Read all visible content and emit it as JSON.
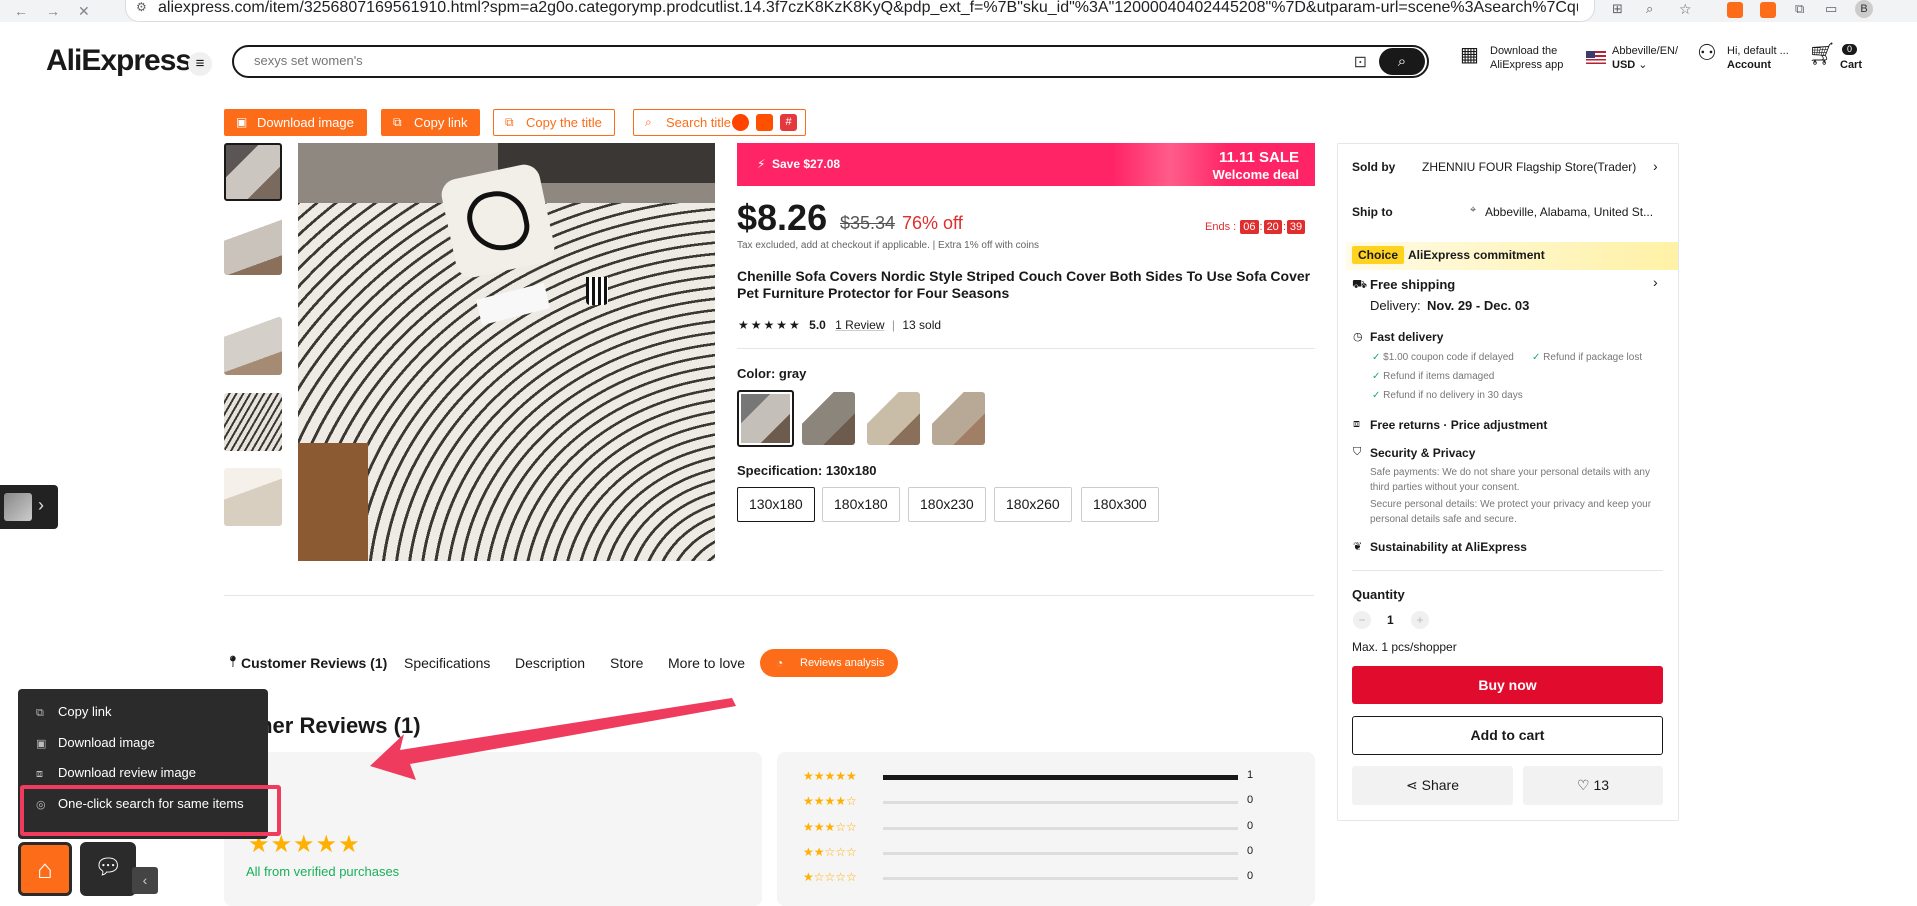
{
  "browser": {
    "url": "aliexpress.com/item/3256807169561910.html?spm=a2g0o.categorymp.prodcutlist.14.3f7czK8KzK8KyQ&pdp_ext_f=%7B\"sku_id\"%3A\"12000040402445208\"%7D&utparam-url=scene%3Asearch%7Cquery_from%3Ac...",
    "profile_initial": "B"
  },
  "header": {
    "logo": "AliExpress",
    "search_placeholder": "sexys set women's",
    "app_line1": "Download the",
    "app_line2": "AliExpress app",
    "region_line1": "Abbeville/EN/",
    "region_line2": "USD",
    "account_line1": "Hi, default ...",
    "account_line2": "Account",
    "cart_count": "0",
    "cart_label": "Cart"
  },
  "toolbar": {
    "download_image": "Download image",
    "copy_link": "Copy link",
    "copy_title": "Copy the title",
    "search_title": "Search title"
  },
  "product": {
    "promo_save": "Save $27.08",
    "promo_sale": "11.11 SALE",
    "promo_welcome": "Welcome deal",
    "price": "$8.26",
    "old_price": "$35.34",
    "discount": "76% off",
    "ends_label": "Ends :",
    "ends_h": "06",
    "ends_m": "20",
    "ends_s": "39",
    "tax": "Tax excluded, add at checkout if applicable.  |  Extra 1% off with coins",
    "title": "Chenille Sofa Covers Nordic Style Striped Couch Cover Both Sides To Use Sofa Cover Pet Furniture Protector for Four Seasons",
    "rating_stars": "★★★★★",
    "rating_value": "5.0",
    "reviews": "1 Review",
    "sold": "13 sold",
    "color_label": "Color: gray",
    "spec_label": "Specification: 130x180",
    "specs": [
      "130x180",
      "180x180",
      "180x230",
      "180x260",
      "180x300"
    ]
  },
  "side": {
    "sold_by_label": "Sold by",
    "sold_by_value": "ZHENNIU FOUR Flagship Store(Trader)",
    "ship_to_label": "Ship to",
    "ship_to_value": "Abbeville, Alabama, United St...",
    "choice": "Choice",
    "commitment": "AliExpress commitment",
    "free_shipping": "Free shipping",
    "delivery_label": "Delivery:",
    "delivery_value": "Nov. 29 - Dec. 03",
    "fast_delivery": "Fast delivery",
    "fd1": "$1.00 coupon code if delayed",
    "fd2": "Refund if package lost",
    "fd3": "Refund if items damaged",
    "fd4": "Refund if no delivery in 30 days",
    "free_returns": "Free returns · Price adjustment",
    "security": "Security & Privacy",
    "sec1": "Safe payments: We do not share your personal details with any third parties without your consent.",
    "sec2": "Secure personal details: We protect your privacy and keep your personal details safe and secure.",
    "sustainability": "Sustainability at AliExpress",
    "quantity_label": "Quantity",
    "quantity_value": "1",
    "max_note": "Max. 1 pcs/shopper",
    "buy_now": "Buy now",
    "add_to_cart": "Add to cart",
    "share": "Share",
    "likes": "13"
  },
  "tabs": {
    "reviews": "Customer Reviews (1)",
    "specifications": "Specifications",
    "description": "Description",
    "store": "Store",
    "more": "More to love",
    "analysis": "Reviews analysis"
  },
  "reviews": {
    "heading": "stomer Reviews (1)",
    "stars": "★★★★★",
    "verified": "All from verified purchases",
    "rows": [
      {
        "stars": "★★★★★",
        "count": "1",
        "fraction": 1.0
      },
      {
        "stars": "★★★★☆",
        "count": "0",
        "fraction": 0
      },
      {
        "stars": "★★★☆☆",
        "count": "0",
        "fraction": 0
      },
      {
        "stars": "★★☆☆☆",
        "count": "0",
        "fraction": 0
      },
      {
        "stars": "★☆☆☆☆",
        "count": "0",
        "fraction": 0
      }
    ]
  },
  "context_menu": {
    "copy_link": "Copy link",
    "download_image": "Download image",
    "download_review_image": "Download review image",
    "one_click_search": "One-click search for same items"
  },
  "colors": {
    "accent_orange": "#fd6d19",
    "sale_pink": "#ff2465",
    "buy_red": "#e00b2d",
    "highlight_red": "#ef3b5d"
  }
}
